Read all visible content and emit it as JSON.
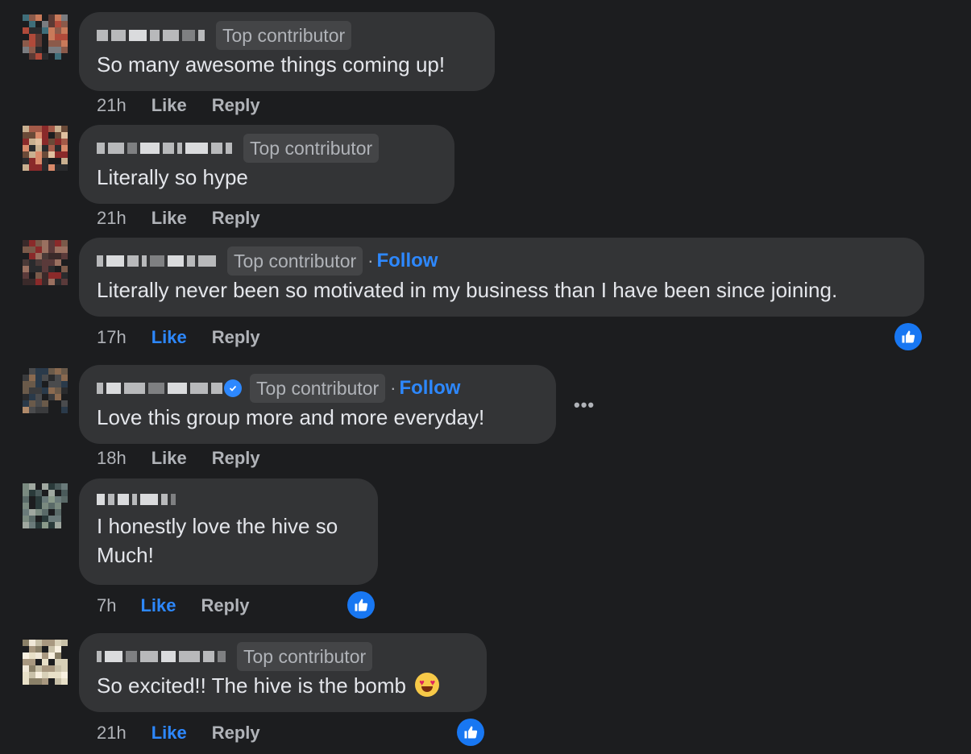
{
  "comments": [
    {
      "badge": "Top contributor",
      "text": "So many awesome things coming up!",
      "time": "21h",
      "like": "Like",
      "reply": "Reply"
    },
    {
      "badge": "Top contributor",
      "text": "Literally so hype",
      "time": "21h",
      "like": "Like",
      "reply": "Reply"
    },
    {
      "badge": "Top contributor",
      "follow": "Follow",
      "text": "Literally never been so motivated in my business than I have been since joining.",
      "time": "17h",
      "like": "Like",
      "reply": "Reply",
      "liked": true
    },
    {
      "badge": "Top contributor",
      "follow": "Follow",
      "text": "Love this group more and more everyday!",
      "time": "18h",
      "like": "Like",
      "reply": "Reply",
      "verified": true
    },
    {
      "text_line1": "I honestly love the hive so",
      "text_line2": "Much!",
      "time": "7h",
      "like": "Like",
      "reply": "Reply",
      "liked": true
    },
    {
      "badge": "Top contributor",
      "text": "So excited!! The hive is the bomb",
      "time": "21h",
      "like": "Like",
      "reply": "Reply",
      "liked": true,
      "emoji": "heart-eyes"
    }
  ],
  "more_menu": "•••",
  "follow_separator": "·",
  "colors": {
    "background": "#1c1d1f",
    "bubble": "#333436",
    "accent": "#2d88ff",
    "muted": "#b0b3b8"
  },
  "icons": {
    "reaction": "thumbs-up-icon",
    "verified": "verified-badge-icon",
    "more": "more-options-icon"
  }
}
